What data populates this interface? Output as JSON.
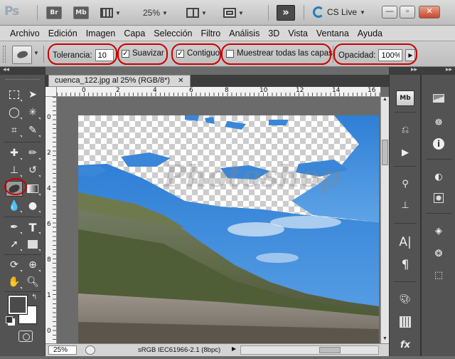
{
  "titlebar": {
    "app_logo": "Ps",
    "bridge_label": "Br",
    "minibridge_label": "Mb",
    "zoom_value": "25%",
    "cslive_label": "CS Live",
    "minimize": "—",
    "restore": "▫",
    "close": "✕"
  },
  "menu": {
    "items": [
      "Archivo",
      "Edición",
      "Imagen",
      "Capa",
      "Selección",
      "Filtro",
      "Análisis",
      "3D",
      "Vista",
      "Ventana",
      "Ayuda"
    ]
  },
  "options": {
    "tolerance_label": "Tolerancia:",
    "tolerance_value": "10",
    "antialias_label": "Suavizar",
    "antialias_checked": true,
    "contiguous_label": "Contiguo",
    "contiguous_checked": true,
    "sample_all_label": "Muestrear todas las capas",
    "sample_all_checked": false,
    "opacity_label": "Opacidad:",
    "opacity_value": "100%",
    "highlight_color": "#c80000"
  },
  "document": {
    "tab_title": "cuenca_122.jpg al 25% (RGB/8*)",
    "zoom": "25%",
    "color_profile": "sRGB IEC61966-2.1 (8bpc)",
    "ruler_numbers": [
      "0",
      "2",
      "4",
      "6",
      "8",
      "10",
      "12",
      "14",
      "16"
    ],
    "vruler_numbers": [
      "0",
      "2",
      "4",
      "6",
      "8",
      "1",
      "0",
      "1",
      "2",
      "1"
    ],
    "watermark": "Photoshop"
  },
  "tools": {
    "active_tool": "background-eraser",
    "foreground_color": "#4b4b4b",
    "background_color": "#ffffff"
  },
  "dock": {
    "minibridge": "Mb",
    "char_panel": "A|",
    "para_panel": "¶",
    "fx": "fx"
  }
}
